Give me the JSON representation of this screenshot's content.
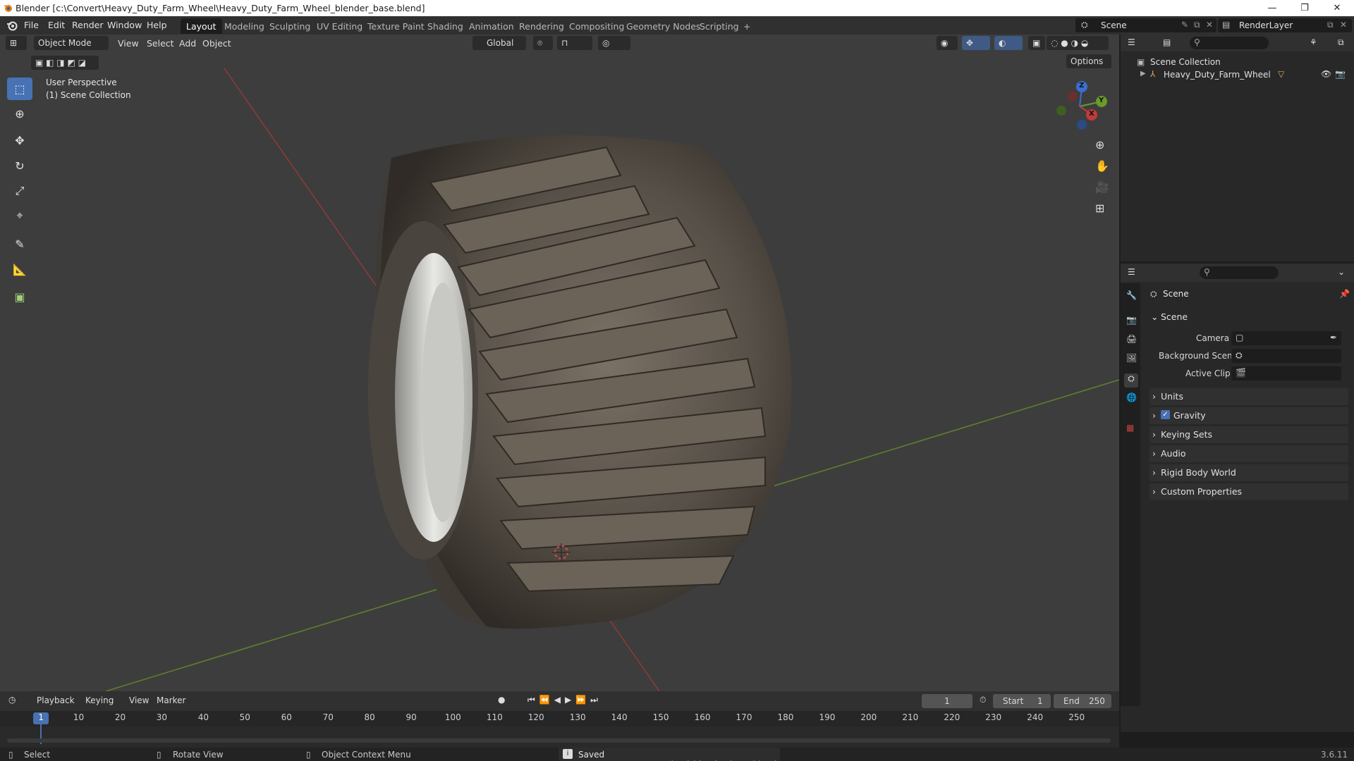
{
  "window": {
    "title": "Blender [c:\\Convert\\Heavy_Duty_Farm_Wheel\\Heavy_Duty_Farm_Wheel_blender_base.blend]",
    "controls": [
      "—",
      "❐",
      "✕"
    ]
  },
  "menu": [
    "File",
    "Edit",
    "Render",
    "Window",
    "Help"
  ],
  "workspaces": [
    "Layout",
    "Modeling",
    "Sculpting",
    "UV Editing",
    "Texture Paint",
    "Shading",
    "Animation",
    "Rendering",
    "Compositing",
    "Geometry Nodes",
    "Scripting",
    "+"
  ],
  "active_workspace": "Layout",
  "scene_selector": "Scene",
  "render_layer": "RenderLayer",
  "viewport_header": {
    "mode": "Object Mode",
    "menus": [
      "View",
      "Select",
      "Add",
      "Object"
    ],
    "transform_orientation": "Global",
    "options": "Options"
  },
  "viewport_overlay": {
    "perspective": "User Perspective",
    "collection": "(1) Scene Collection"
  },
  "gizmo": {
    "z": "Z",
    "y": "Y",
    "x": "X"
  },
  "outliner": {
    "root": "Scene Collection",
    "items": [
      "Heavy_Duty_Farm_Wheel"
    ]
  },
  "properties": {
    "header": "Scene",
    "section": "Scene",
    "fields": [
      {
        "label": "Camera"
      },
      {
        "label": "Background Scene"
      },
      {
        "label": "Active Clip"
      }
    ],
    "panels": [
      "Units",
      "Gravity",
      "Keying Sets",
      "Audio",
      "Rigid Body World",
      "Custom Properties"
    ],
    "gravity_checked": true
  },
  "timeline": {
    "menus": [
      "Playback",
      "Keying",
      "View",
      "Marker"
    ],
    "current_frame": "1",
    "start_label": "Start",
    "start": "1",
    "end_label": "End",
    "end": "250",
    "ticks": [
      "1",
      "10",
      "20",
      "30",
      "40",
      "50",
      "60",
      "70",
      "80",
      "90",
      "100",
      "110",
      "120",
      "130",
      "140",
      "150",
      "160",
      "170",
      "180",
      "190",
      "200",
      "210",
      "220",
      "230",
      "240",
      "250"
    ]
  },
  "statusbar": {
    "select": "Select",
    "rotate": "Rotate View",
    "context": "Object Context Menu",
    "message": "Saved \"Heavy_Duty_Farm_Wheel_blender_base.blend\"",
    "version": "3.6.11"
  },
  "colors": {
    "accent": "#4772b3",
    "x_axis": "#c03a3a",
    "y_axis": "#6a9a2a",
    "z_axis": "#3a6fd0"
  }
}
